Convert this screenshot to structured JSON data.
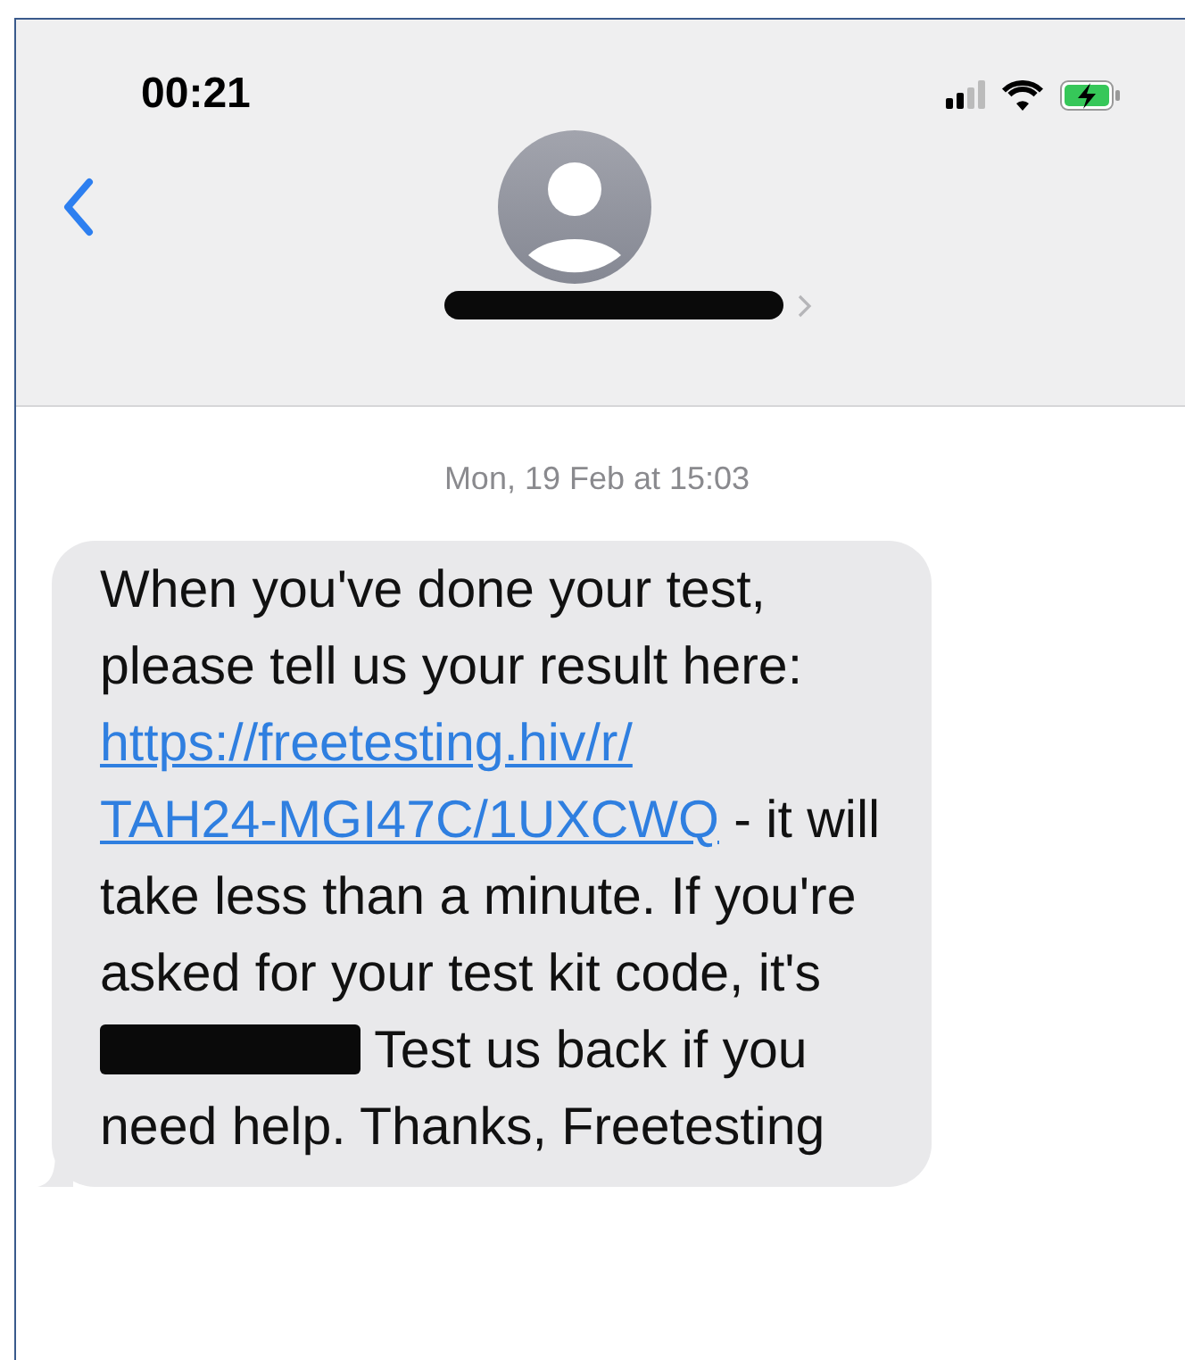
{
  "status_bar": {
    "time": "00:21"
  },
  "header": {
    "contact": {
      "redacted": true
    }
  },
  "thread": {
    "timestamp": "Mon, 19 Feb at 15:03",
    "messages": [
      {
        "parts": [
          {
            "kind": "text",
            "text": "When you've done your test, please tell us your result here: "
          },
          {
            "kind": "link",
            "text": "https://freetesting.hiv/r/"
          },
          {
            "kind": "link",
            "text": "TAH24-MGI47C/1UXCWQ"
          },
          {
            "kind": "text",
            "text": " - it will take less than a minute. If you're asked for your test kit code, it's"
          },
          {
            "kind": "redacted"
          },
          {
            "kind": "text",
            "text": " Test us back if you need help. Thanks, Freetesting"
          }
        ]
      }
    ]
  }
}
